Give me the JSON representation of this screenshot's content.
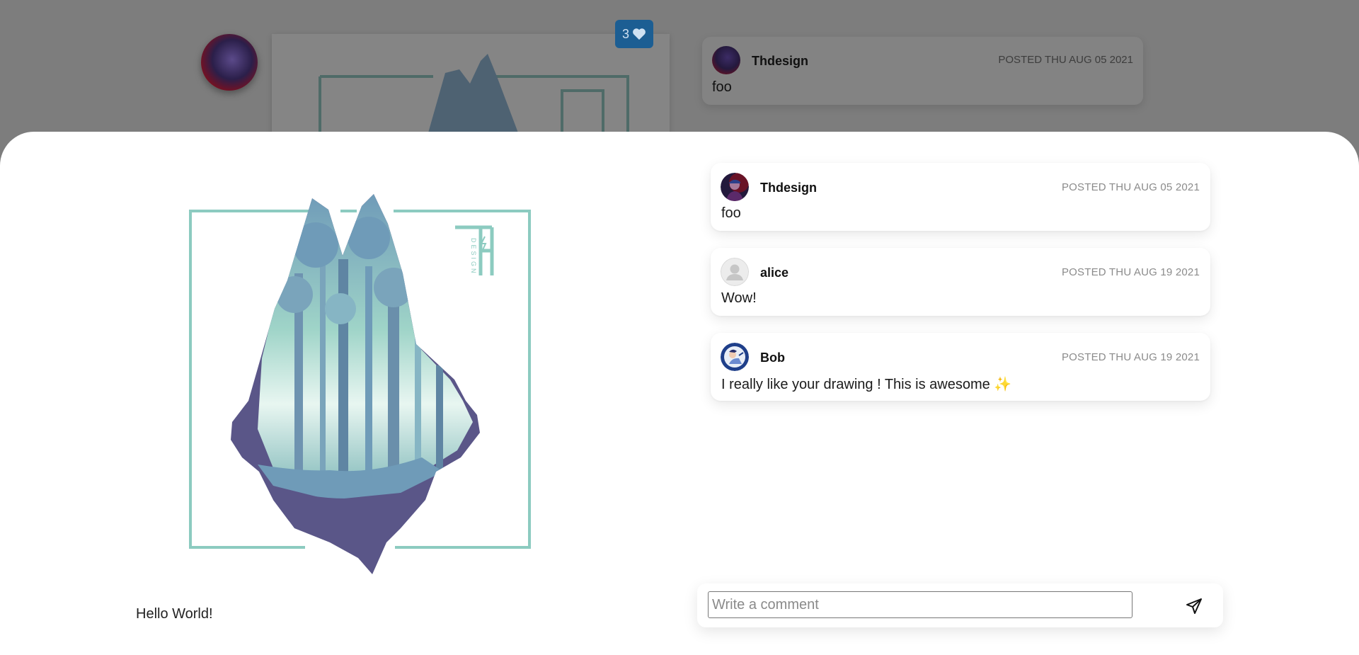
{
  "background": {
    "likes_count": "3",
    "comment": {
      "author": "Thdesign",
      "date": "POSTED THU AUG 05 2021",
      "text": "foo"
    }
  },
  "post": {
    "caption": "Hello World!",
    "logo_text": "DESIGN"
  },
  "comments": [
    {
      "author": "Thdesign",
      "date": "POSTED THU AUG 05 2021",
      "text": "foo",
      "avatar": "profile-photo"
    },
    {
      "author": "alice",
      "date": "POSTED THU AUG 19 2021",
      "text": "Wow!",
      "avatar": "default-user-icon"
    },
    {
      "author": "Bob",
      "date": "POSTED THU AUG 19 2021",
      "text": "I really like your drawing ! This is awesome",
      "emoji": "✨",
      "avatar": "profile-photo"
    }
  ],
  "composer": {
    "placeholder": "Write a comment",
    "send_icon": "paper-plane-icon"
  },
  "colors": {
    "frame_teal": "#8ccbc0",
    "wolf_purple": "#5a5688",
    "forest_blue": "#6f9bb8",
    "likes_badge": "#1c5e93"
  }
}
